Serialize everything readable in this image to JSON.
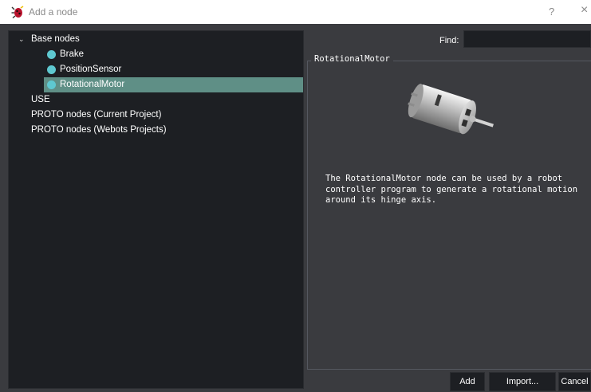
{
  "window": {
    "title": "Add a node",
    "help_glyph": "?",
    "close_glyph": "×"
  },
  "tree": {
    "items": [
      {
        "label": "Base nodes",
        "expanded": true
      },
      {
        "label": "Brake"
      },
      {
        "label": "PositionSensor"
      },
      {
        "label": "RotationalMotor",
        "selected": true
      },
      {
        "label": "USE"
      },
      {
        "label": "PROTO nodes (Current Project)"
      },
      {
        "label": "PROTO nodes (Webots Projects)"
      }
    ],
    "expand_glyph": "⌄"
  },
  "find": {
    "label": "Find:",
    "value": ""
  },
  "details": {
    "group_title": "RotationalMotor",
    "description": "The RotationalMotor node can be used by a robot controller program to generate a rotational motion around its hinge axis."
  },
  "buttons": {
    "add": "Add",
    "import": "Import...",
    "cancel": "Cancel"
  },
  "colors": {
    "panel_dark": "#1d1f23",
    "background": "#3a3b3f",
    "selection": "#5f8f86",
    "node_dot": "#5ec8d0"
  }
}
